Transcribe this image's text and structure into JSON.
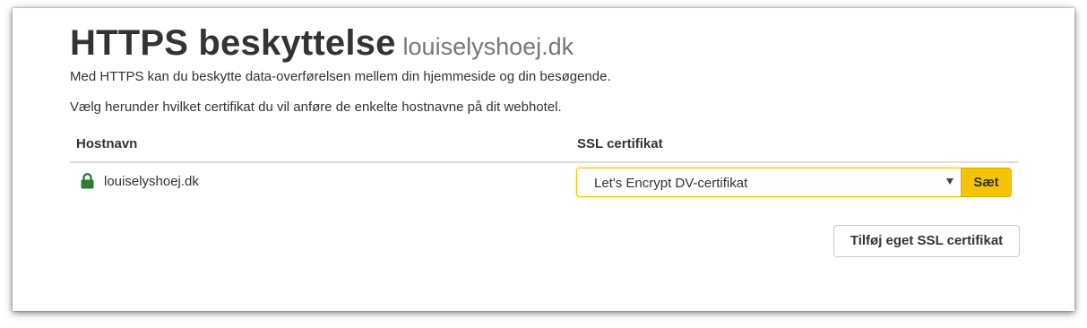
{
  "header": {
    "title": "HTTPS beskyttelse",
    "domain": "louiselyshoej.dk"
  },
  "intro": {
    "line1": "Med HTTPS kan du beskytte data-overførelsen mellem din hjemmeside og din besøgende.",
    "line2": "Vælg herunder hvilket certifikat du vil anføre de enkelte hostnavne på dit webhotel."
  },
  "table": {
    "columns": {
      "hostname": "Hostnavn",
      "ssl": "SSL certifikat"
    },
    "rows": [
      {
        "hostname": "louiselyshoej.dk",
        "icon": "lock-icon",
        "certificate": "Let's Encrypt DV-certifikat",
        "set_label": "Sæt"
      }
    ]
  },
  "actions": {
    "add_ssl_label": "Tilføj eget SSL certifikat"
  },
  "colors": {
    "lock": "#2e7d32",
    "accent": "#f5c400",
    "text": "#333333",
    "muted": "#777777"
  }
}
